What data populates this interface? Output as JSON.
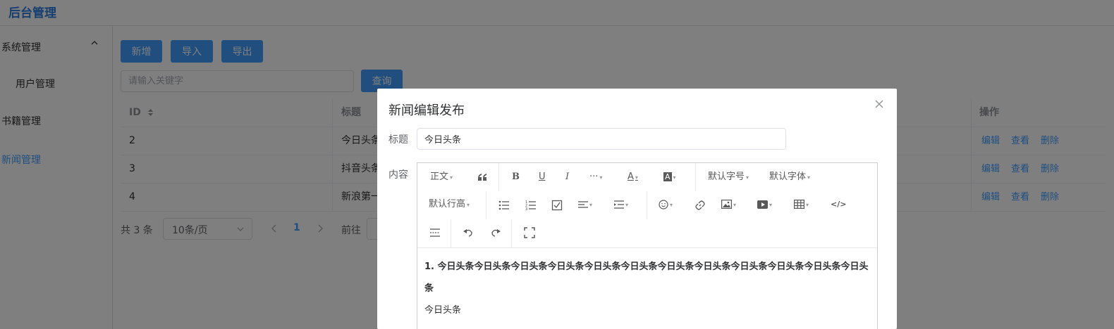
{
  "app": {
    "title": "后台管理"
  },
  "sidebar": {
    "items": [
      {
        "label": "系统管理"
      },
      {
        "label": "用户管理"
      },
      {
        "label": "书籍管理"
      },
      {
        "label": "新闻管理"
      }
    ]
  },
  "toolbar": {
    "add": "新增",
    "import": "导入",
    "export": "导出"
  },
  "search": {
    "placeholder": "请输入关键字",
    "button": "查询"
  },
  "table": {
    "headers": {
      "id": "ID",
      "title": "标题",
      "actions": "操作"
    },
    "rows": [
      {
        "id": "2",
        "title": "今日头条"
      },
      {
        "id": "3",
        "title": "抖音头条"
      },
      {
        "id": "4",
        "title": "新浪第一"
      }
    ],
    "actions": {
      "edit": "编辑",
      "view": "查看",
      "delete": "删除"
    }
  },
  "pagination": {
    "total": "共 3 条",
    "page_size": "10条/页",
    "current_page": "1",
    "goto_label": "前往"
  },
  "dialog": {
    "title": "新闻编辑发布",
    "title_label": "标题",
    "title_value": "今日头条",
    "content_label": "内容",
    "editor": {
      "paragraph": "正文",
      "font_size": "默认字号",
      "font_family": "默认字体",
      "line_height": "默认行高"
    },
    "content_line1": "1. 今日头条今日头条今日头条今日头条今日头条今日头条今日头条今日头条今日头条今日头条今日头条今日头条",
    "content_line2": "今日头条"
  }
}
